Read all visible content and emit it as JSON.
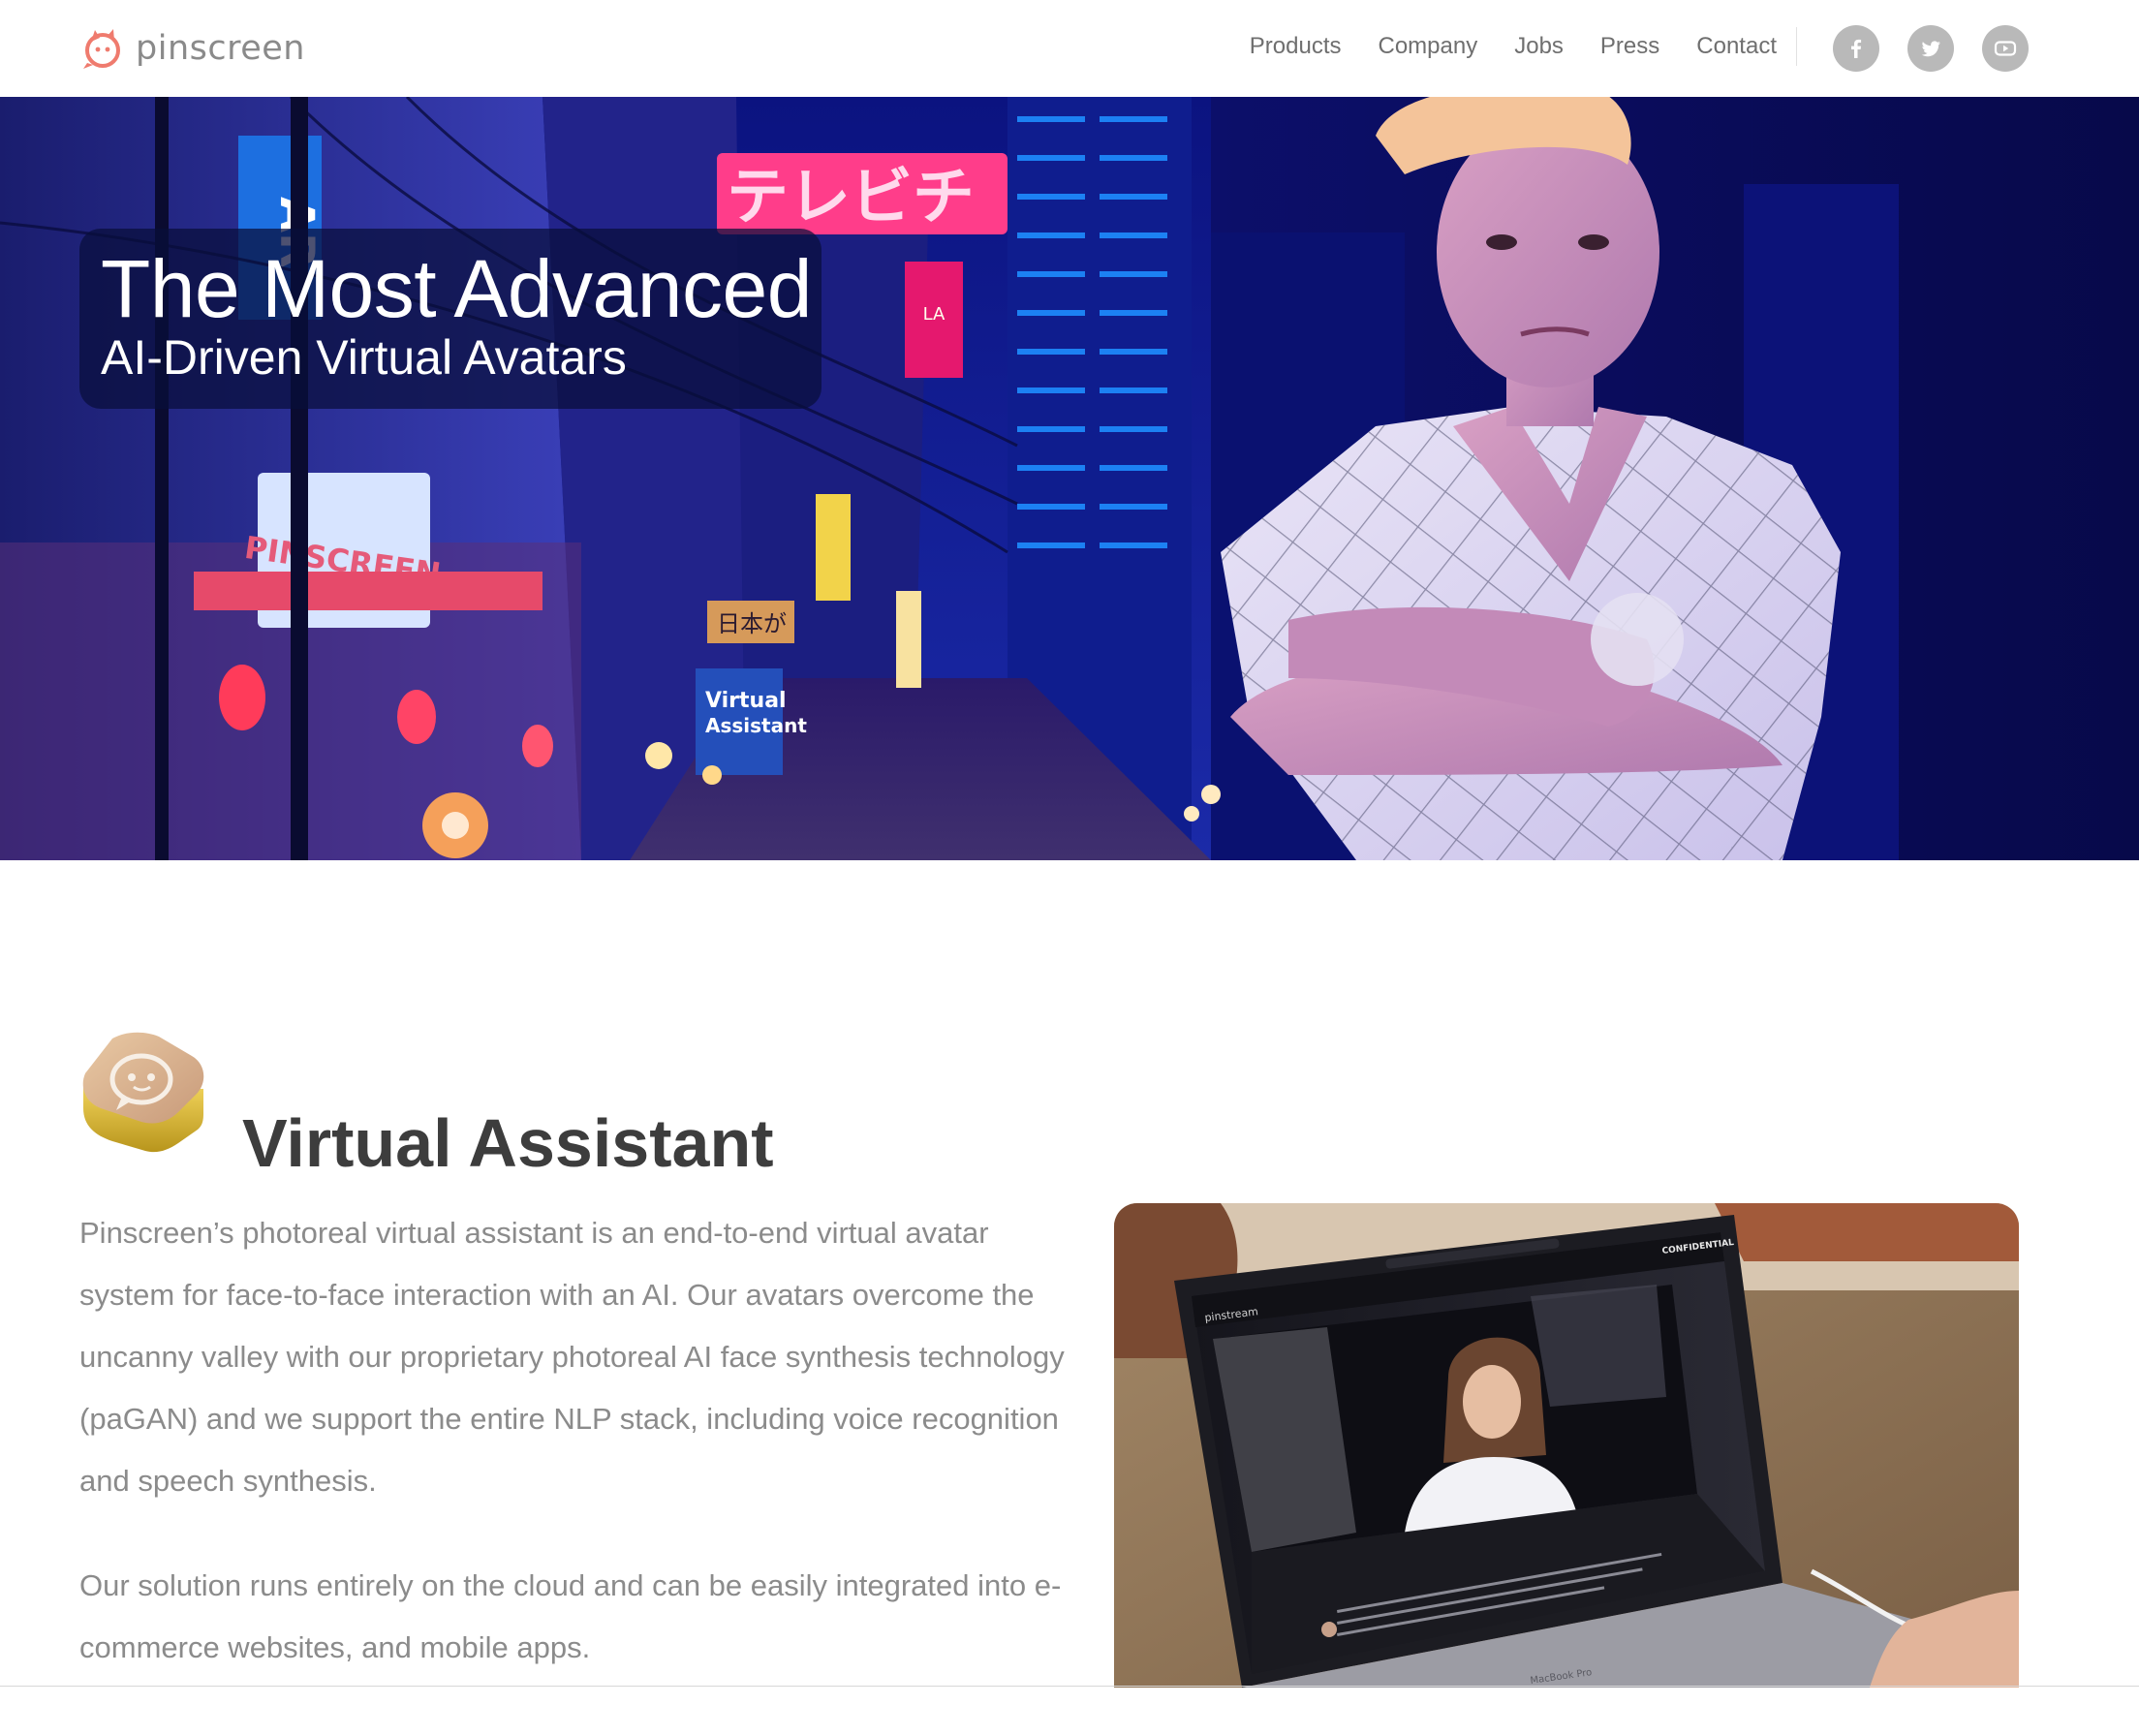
{
  "brand": {
    "name": "pinscreen",
    "accent": "#ef7b6e"
  },
  "nav": {
    "items": [
      {
        "label": "Products"
      },
      {
        "label": "Company"
      },
      {
        "label": "Jobs"
      },
      {
        "label": "Press"
      },
      {
        "label": "Contact"
      }
    ],
    "social": [
      {
        "icon": "facebook-icon"
      },
      {
        "icon": "twitter-icon"
      },
      {
        "icon": "youtube-icon"
      }
    ]
  },
  "hero": {
    "title": "The Most Advanced",
    "subtitle": "AI-Driven Virtual Avatars",
    "scene_signs": [
      "テレビチ",
      "AR",
      "LA",
      "PINSCREEN",
      "Virtual",
      "Assistant",
      "日本が"
    ]
  },
  "section": {
    "icon": "virtual-assistant-app-icon",
    "title": "Virtual Assistant",
    "paragraphs": [
      "Pinscreen’s photoreal virtual assistant is an end-to-end virtual avatar system for face-to-face interaction with an AI. Our avatars overcome the uncanny valley with our proprietary photoreal AI face synthesis technology (paGAN) and we support the entire NLP stack, including voice recognition and speech synthesis.",
      "Our solution runs entirely on the cloud and can be easily integrated into e-commerce websites, and mobile apps."
    ],
    "video_labels": {
      "app": "pinstream",
      "confidential": "CONFIDENTIAL",
      "laptop": "MacBook Pro"
    }
  }
}
